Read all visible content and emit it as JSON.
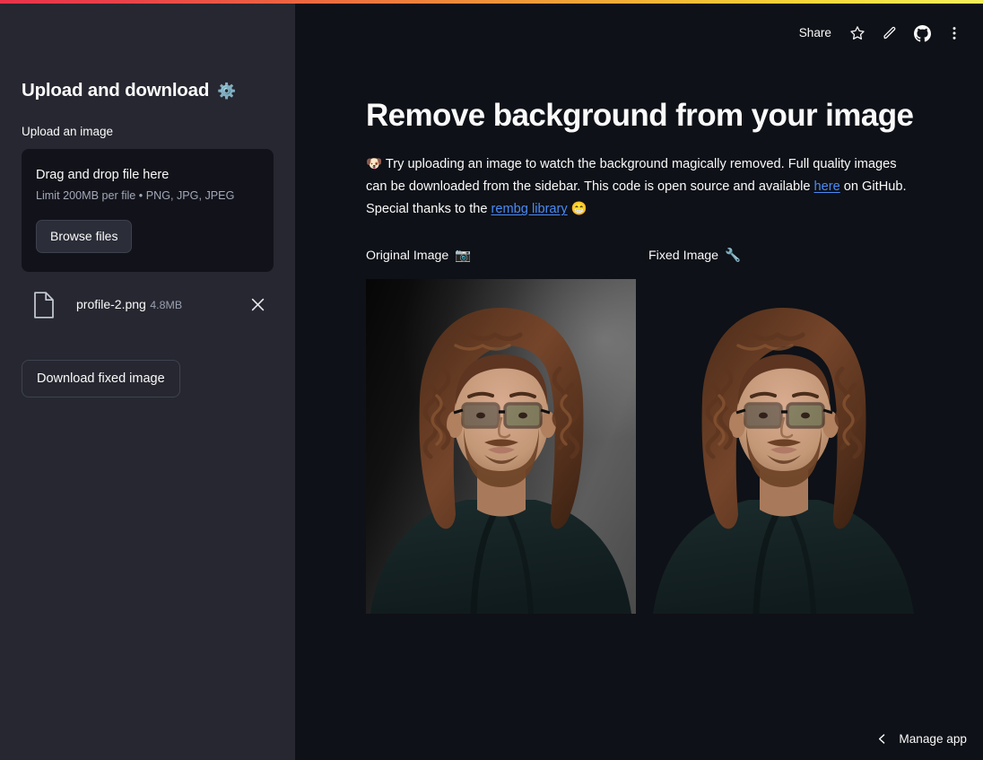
{
  "app": {
    "background_main": "#0e1117",
    "background_sidebar": "#262730",
    "accent_link": "#4a8bf5",
    "top_gradient": [
      "#e8334a",
      "#f0923b",
      "#f6f05c"
    ]
  },
  "toolbar": {
    "share_label": "Share",
    "icons": [
      {
        "name": "star-icon",
        "glyph": "star"
      },
      {
        "name": "pencil-icon",
        "glyph": "pencil"
      },
      {
        "name": "github-icon",
        "glyph": "github"
      },
      {
        "name": "overflow-menu-icon",
        "glyph": "kebab"
      }
    ]
  },
  "sidebar": {
    "title": "Upload and download",
    "title_emoji": "⚙️",
    "uploader": {
      "label": "Upload an image",
      "dropzone_title": "Drag and drop file here",
      "dropzone_hint": "Limit 200MB per file • PNG, JPG, JPEG",
      "browse_label": "Browse files"
    },
    "uploaded_file": {
      "icon": "document-icon",
      "name": "profile-2.png",
      "size": "4.8MB",
      "remove_icon": "close-icon"
    },
    "download_button_label": "Download fixed image"
  },
  "main": {
    "title": "Remove background from your image",
    "description": {
      "lead_emoji": "🐶",
      "text_1": "Try uploading an image to watch the background magically removed. Full quality images can be downloaded from the sidebar. This code is open source and available ",
      "link_1": "here",
      "text_2": " on GitHub. Special thanks to the ",
      "link_2": "rembg library",
      "text_3": " ",
      "trailing_emoji": "😁"
    },
    "images": [
      {
        "caption": "Original Image",
        "emoji": "📷",
        "name": "original-image",
        "background_removed": false
      },
      {
        "caption": "Fixed Image",
        "emoji": "🔧",
        "name": "fixed-image",
        "background_removed": true
      }
    ]
  },
  "footer": {
    "manage_app_label": "Manage app",
    "chevron_icon": "chevron-left-icon"
  }
}
